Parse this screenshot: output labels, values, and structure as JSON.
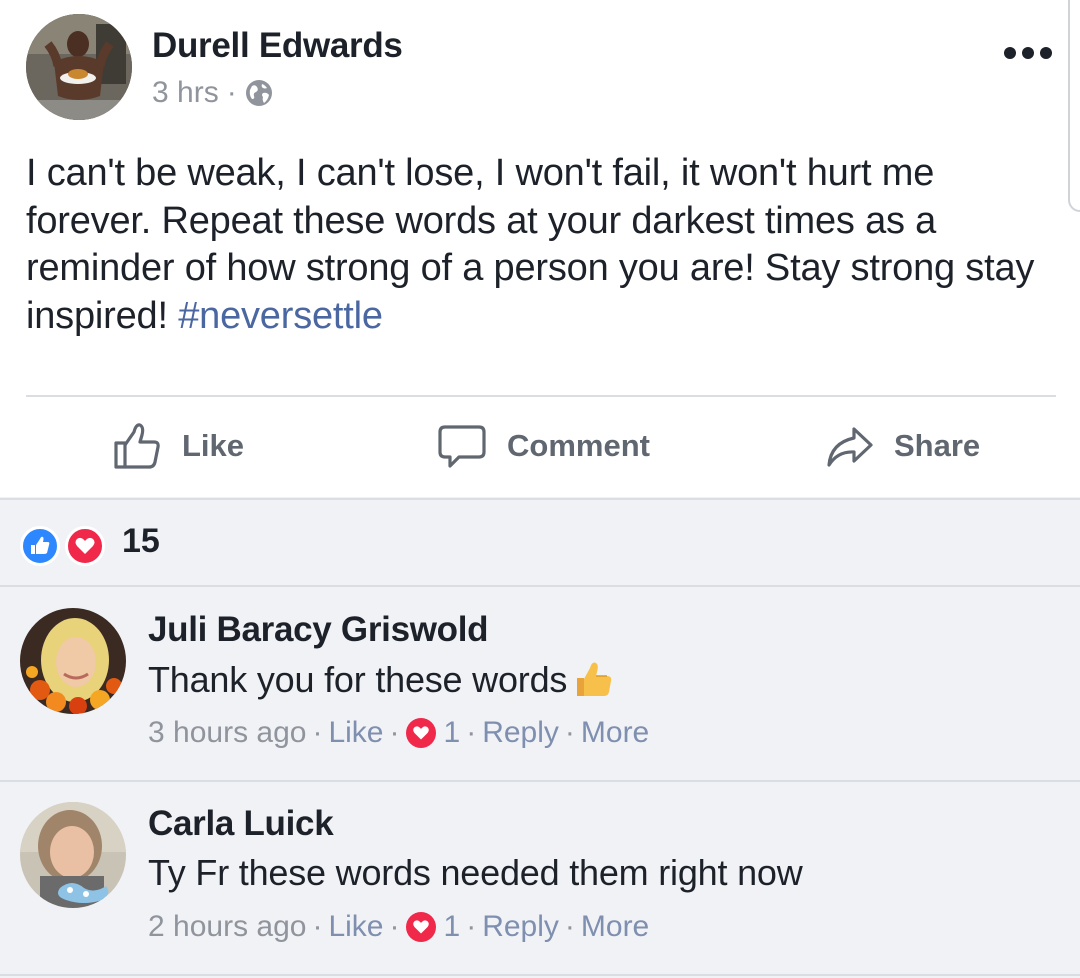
{
  "post": {
    "author": "Durell Edwards",
    "time": "3 hrs",
    "meta_sep": "·",
    "privacy_icon": "globe-icon",
    "text": "I can't be weak, I can't lose, I won't fail, it won't hurt me forever. Repeat these words at your darkest times as a reminder of how strong of a person you are! Stay strong stay inspired!",
    "hashtag": "#neversettle",
    "actions": {
      "like": "Like",
      "comment": "Comment",
      "share": "Share"
    }
  },
  "reactions": {
    "types": [
      "like",
      "love"
    ],
    "count": "15"
  },
  "comments": [
    {
      "author": "Juli Baracy Griswold",
      "text": "Thank you for these words",
      "emoji": "thumbs-up-emoji",
      "time": "3 hours ago",
      "like": "Like",
      "reaction_count": "1",
      "reply": "Reply",
      "more": "More"
    },
    {
      "author": "Carla Luick",
      "text": "Ty Fr these words needed them right now",
      "time": "2 hours ago",
      "like": "Like",
      "reaction_count": "1",
      "reply": "Reply",
      "more": "More"
    }
  ],
  "colors": {
    "hashtag": "#4b67a1",
    "like_blue": "#2d88ff",
    "love_red": "#f0284a",
    "meta_gray": "#90949c",
    "background": "#f1f2f6"
  }
}
